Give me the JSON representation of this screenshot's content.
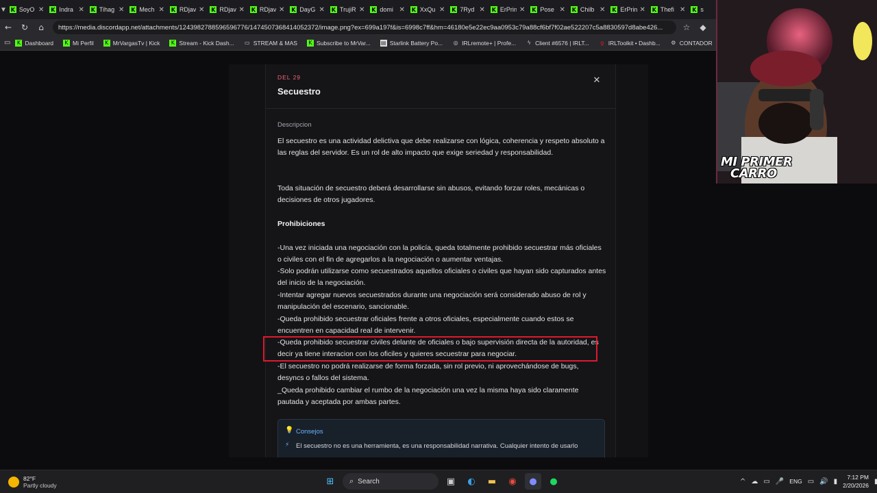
{
  "browser": {
    "tabs": [
      {
        "label": "SoyO"
      },
      {
        "label": "Indra"
      },
      {
        "label": "Tihag"
      },
      {
        "label": "Mech"
      },
      {
        "label": "RDjav"
      },
      {
        "label": "RDjav"
      },
      {
        "label": "RDjav"
      },
      {
        "label": "DayG"
      },
      {
        "label": "TrujiR"
      },
      {
        "label": "domi"
      },
      {
        "label": "XxQu"
      },
      {
        "label": "7Ryd"
      },
      {
        "label": "ErPrin"
      },
      {
        "label": "Pose"
      },
      {
        "label": "Chilb"
      },
      {
        "label": "ErPrin"
      },
      {
        "label": "Thefi"
      },
      {
        "label": "s"
      }
    ],
    "url": "https://media.discordapp.net/attachments/1243982788596596776/1474507368414052372/image.png?ex=699a197f&is=6998c7ff&hm=46180e5e22ec9aa0953c79a88cf6bf7f02ae522207c5a8830597d8abe426...",
    "bookmarks": [
      {
        "label": "Dashboard",
        "icon": "kick"
      },
      {
        "label": "Mi Perfil",
        "icon": "kick"
      },
      {
        "label": "MrVargasTv | Kick",
        "icon": "kick"
      },
      {
        "label": "Stream - Kick Dash...",
        "icon": "kick"
      },
      {
        "label": "STREAM & MAS",
        "icon": "folder"
      },
      {
        "label": "Subscribe to MrVar...",
        "icon": "kick"
      },
      {
        "label": "Starlink Battery Po...",
        "icon": "page"
      },
      {
        "label": "IRLremote+ | Profe...",
        "icon": "globe"
      },
      {
        "label": "Client #6576 | IRLT...",
        "icon": "bolt"
      },
      {
        "label": "IRLToolkit • Dashb...",
        "icon": "g"
      },
      {
        "label": "CONTADOR",
        "icon": "gear"
      }
    ]
  },
  "modal": {
    "eyebrow": "DEL 29",
    "title": "Secuestro",
    "description_label": "Descripcion",
    "description_1": "El secuestro es una actividad delictiva que debe realizarse con lógica, coherencia y respeto absoluto a las reglas del servidor. Es un rol de alto impacto que exige seriedad y responsabilidad.",
    "description_2": "Toda situación de secuestro deberá desarrollarse sin abusos, evitando forzar roles, mecánicas o decisiones de otros jugadores.",
    "prohibitions_heading": "Prohibiciones",
    "rules": [
      "-Una vez iniciada una negociación con la policía, queda totalmente prohibido secuestrar más oficiales o civiles con el fin de agregarlos a la negociación o aumentar ventajas.",
      "-Solo podrán utilizarse como secuestrados aquellos oficiales o civiles que hayan sido capturados antes del inicio de la negociación.",
      "-Intentar agregar nuevos secuestrados durante una negociación será considerado abuso de rol y manipulación del escenario, sancionable.",
      "-Queda prohibido secuestrar oficiales frente a otros oficiales, especialmente cuando estos se encuentren en capacidad real de intervenir.",
      "-Queda prohibido secuestrar civiles delante de oficiales o bajo supervisión directa de la autoridad, es decir ya tiene interacion con los oficiles y quieres secuestrar para negociar.",
      "-El secuestro no podrá realizarse de forma forzada, sin rol previo, ni aprovechándose de bugs, desyncs o fallos del sistema.",
      "_Queda prohibido cambiar el rumbo de la negociación una vez la misma haya sido claramente pautada y aceptada por ambas partes."
    ],
    "tips_title": "Consejos",
    "tips_text": "El secuestro no es una herramienta, es una responsabilidad narrativa. Cualquier intento de usarlo"
  },
  "webcam": {
    "overlay_line1": "MI PRIMER",
    "overlay_line2": "CARRO"
  },
  "taskbar": {
    "temperature": "82°F",
    "weather": "Partly cloudy",
    "search_label": "Search",
    "language": "ENG",
    "time": "7:12 PM",
    "date": "2/20/2026"
  },
  "colors": {
    "kick_green": "#53fc18",
    "accent_red": "#f0657a",
    "highlight_red": "#e0182d",
    "tips_blue": "#6fb3ff"
  }
}
